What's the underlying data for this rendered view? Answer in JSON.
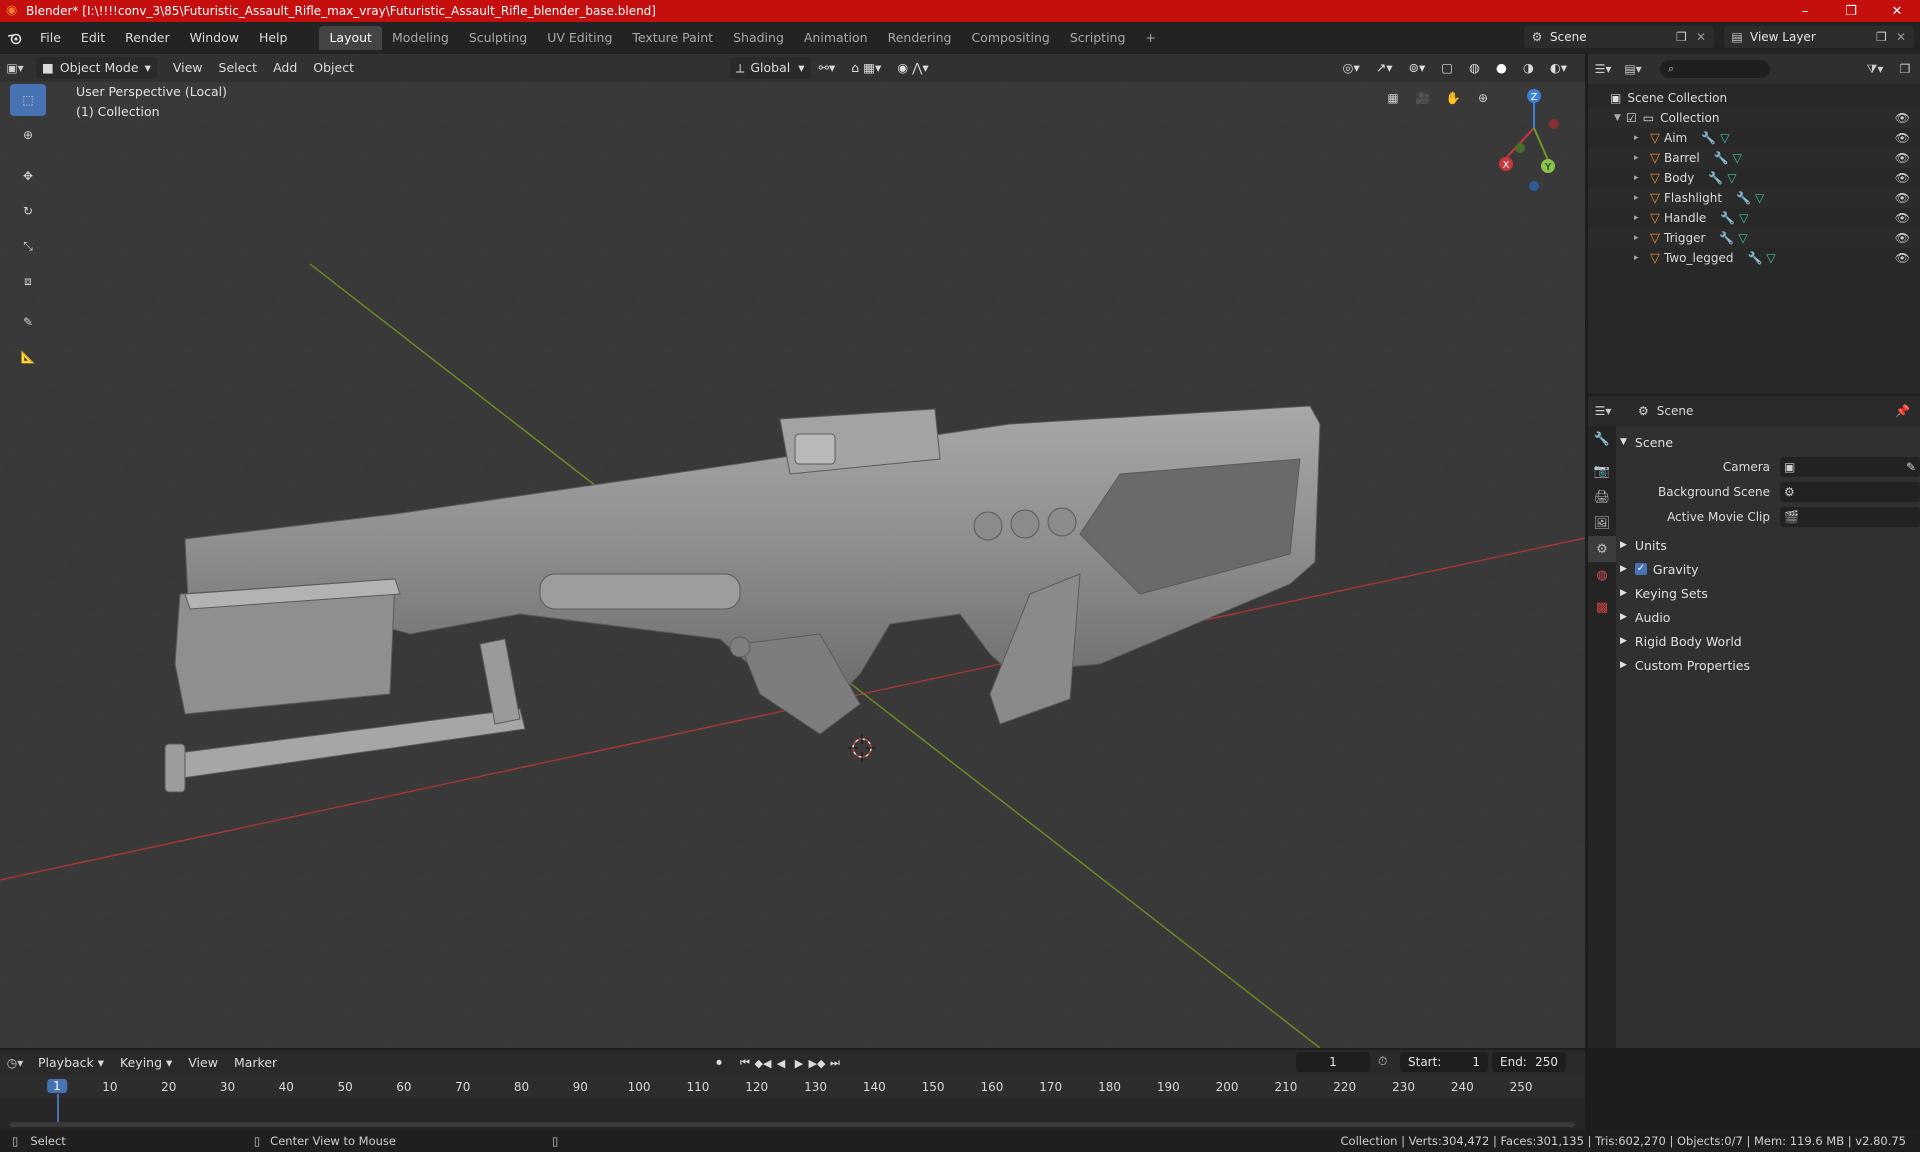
{
  "window": {
    "title": "Blender* [I:\\!!!!conv_3\\85\\Futuristic_Assault_Rifle_max_vray\\Futuristic_Assault_Rifle_blender_base.blend]",
    "minimize": "–",
    "maximize": "❐",
    "close": "✕"
  },
  "menu": [
    "File",
    "Edit",
    "Render",
    "Window",
    "Help"
  ],
  "workspaces": [
    "Layout",
    "Modeling",
    "Sculpting",
    "UV Editing",
    "Texture Paint",
    "Shading",
    "Animation",
    "Rendering",
    "Compositing",
    "Scripting"
  ],
  "add_workspace": "+",
  "scene_name": "Scene",
  "view_layer": "View Layer",
  "viewport": {
    "mode": "Object Mode",
    "menus": [
      "View",
      "Select",
      "Add",
      "Object"
    ],
    "transform_orientation": "Global",
    "perspective_label": "User Perspective (Local)",
    "collection_label": "(1) Collection",
    "gizmo": {
      "x": "X",
      "y": "Y",
      "z": "Z"
    }
  },
  "outliner": {
    "root": "Scene Collection",
    "collection": "Collection",
    "objects": [
      "Aim",
      "Barrel",
      "Body",
      "Flashlight",
      "Handle",
      "Trigger",
      "Two_legged"
    ]
  },
  "properties": {
    "context": "Scene",
    "panel_scene": "Scene",
    "camera_label": "Camera",
    "background_scene_label": "Background Scene",
    "active_movie_clip_label": "Active Movie Clip",
    "panels": [
      "Units",
      "Gravity",
      "Keying Sets",
      "Audio",
      "Rigid Body World",
      "Custom Properties"
    ]
  },
  "timeline": {
    "menus": [
      "Playback",
      "Keying",
      "View",
      "Marker"
    ],
    "current_frame": "1",
    "start_label": "Start:",
    "start": "1",
    "end_label": "End:",
    "end": "250",
    "ticks": [
      "1",
      "10",
      "20",
      "30",
      "40",
      "50",
      "60",
      "70",
      "80",
      "90",
      "100",
      "110",
      "120",
      "130",
      "140",
      "150",
      "160",
      "170",
      "180",
      "190",
      "200",
      "210",
      "220",
      "230",
      "240",
      "250"
    ]
  },
  "statusbar": {
    "select": "Select",
    "center_view": "Center View to Mouse",
    "stats": "Collection | Verts:304,472 | Faces:301,135 | Tris:602,270 | Objects:0/7 | Mem: 119.6 MB | v2.80.75"
  },
  "colors": {
    "title_bar": "#c50e0e",
    "accent": "#4772b3",
    "mesh": "#e38b2f",
    "x_axis": "#c8373e",
    "y_axis": "#6b9a2a",
    "z_axis": "#3c7fd6"
  }
}
